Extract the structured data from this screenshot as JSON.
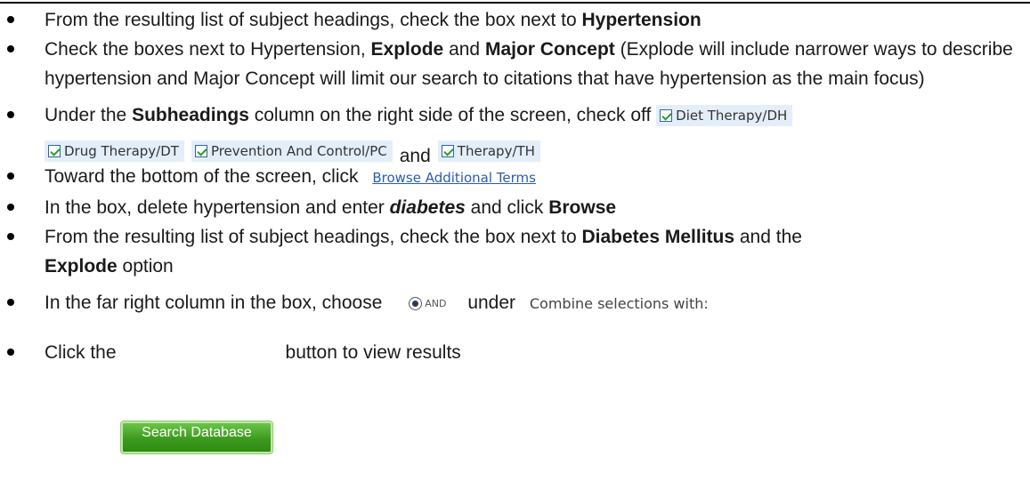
{
  "steps": [
    {
      "pre": "From the resulting list of subject headings, check the box next to ",
      "b1": "Hypertension"
    },
    {
      "pre": "Check the boxes next to Hypertension, ",
      "b1": "Explode",
      "mid": " and ",
      "b2": "Major Concept",
      "post": " (Explode will include narrower ways to describe hypertension and Major Concept will limit our search to citations that have hypertension as the main focus)"
    },
    {
      "pre": "Under the ",
      "b1": "Subheadings",
      "post": " column on the right side of the screen, check off"
    },
    {
      "pre": "Toward the bottom of the screen, click"
    },
    {
      "pre": "In the box, delete hypertension and enter ",
      "bi": "diabetes",
      "mid": " and click ",
      "b1": "Browse"
    },
    {
      "pre": "From the resulting list of subject headings, check the box next to ",
      "b1": "Diabetes Mellitus",
      "mid": " and the ",
      "b2": "Explode",
      "post": " option"
    },
    {
      "pre": "In the far right column in the box, choose",
      "mid": "under"
    },
    {
      "pre": "Click the",
      "post": "button to view results"
    }
  ],
  "subheadings": {
    "diet": "Diet Therapy/DH",
    "drug": "Drug Therapy/DT",
    "prevention": "Prevention And Control/PC",
    "and_word": "and",
    "therapy": "Therapy/TH"
  },
  "browse_link": "Browse Additional Terms",
  "and_radio_label": "AND",
  "combine_label": "Combine selections with:",
  "search_button": "Search Database",
  "colors": {
    "button_green": "#3c9a1e",
    "link_blue": "#2a5db0",
    "chip_bg": "#e4eef9"
  }
}
